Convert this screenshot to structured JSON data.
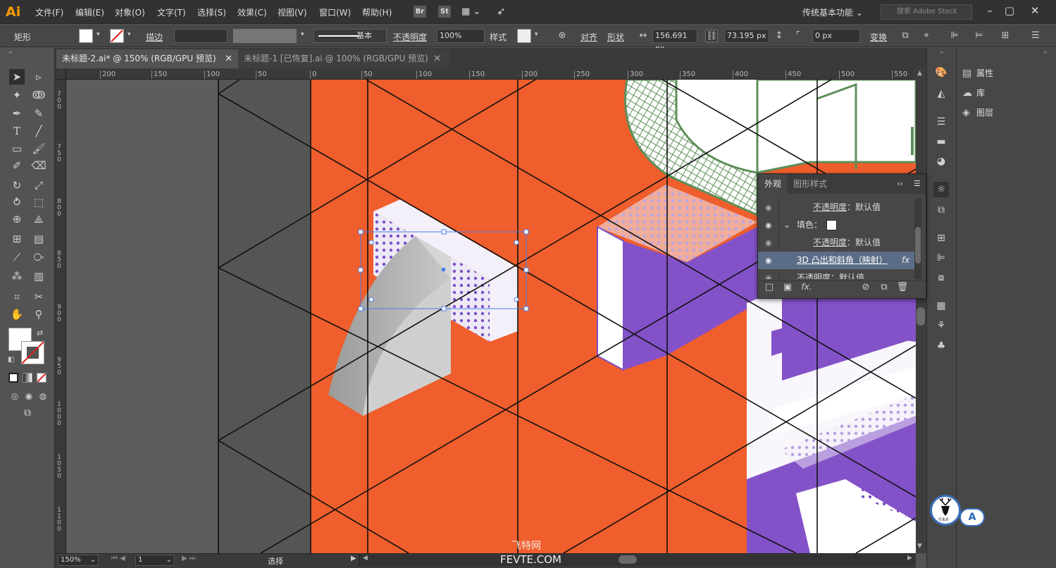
{
  "app": {
    "logo": "Ai"
  },
  "menu": [
    "文件(F)",
    "编辑(E)",
    "对象(O)",
    "文字(T)",
    "选择(S)",
    "效果(C)",
    "视图(V)",
    "窗口(W)",
    "帮助(H)"
  ],
  "menu_icons": {
    "bridge": "Br",
    "stock": "St"
  },
  "workspace": "传统基本功能",
  "search_placeholder": "搜索 Adobe Stock",
  "control": {
    "selection": "矩形",
    "stroke_label": "描边",
    "stroke_profile": "基本",
    "opacity_label": "不透明度",
    "opacity": "100%",
    "style_label": "样式",
    "align_label": "对齐",
    "shape_label": "形状",
    "width": "156.691 px",
    "height": "73.195 px",
    "corner": "0 px",
    "transform_label": "变换"
  },
  "tabs": [
    {
      "label": "未标题-2.ai* @ 150% (RGB/GPU 预览)"
    },
    {
      "label": "未标题-1 [已恢复].ai @ 100% (RGB/GPU 预览)"
    }
  ],
  "hruler_labels": [
    "200",
    "150",
    "100",
    "50",
    "0",
    "50",
    "100",
    "150",
    "200",
    "250",
    "300",
    "350",
    "400",
    "450",
    "500",
    "550"
  ],
  "vruler_labels": [
    "700",
    "750",
    "800",
    "850",
    "900",
    "950",
    "1000",
    "1050",
    "1100"
  ],
  "appearance": {
    "tabs": [
      "外观",
      "图形样式"
    ],
    "rows": [
      {
        "label": "不透明度",
        "value": "默认值"
      },
      {
        "label": "填色",
        "value": ""
      },
      {
        "label": "不透明度",
        "value": "默认值"
      },
      {
        "label": "3D 凸出和斜角（映射）",
        "value": ""
      },
      {
        "label": "不透明度",
        "value": "默认值"
      }
    ],
    "fx": "fx"
  },
  "right_panel": [
    "属性",
    "库",
    "图层"
  ],
  "status": {
    "zoom": "150%",
    "page": "1",
    "tool": "选择"
  },
  "watermark": {
    "line1": "飞特网",
    "line2": "FEVTE.COM"
  },
  "badge": {
    "letter": "A",
    "text": "行永乐"
  },
  "colors": {
    "canvas": "#ef5e2c",
    "purple": "#8452c8",
    "green": "#5e8f5a",
    "dots": "#7b4fc6",
    "selection": "#4a7ff0"
  }
}
